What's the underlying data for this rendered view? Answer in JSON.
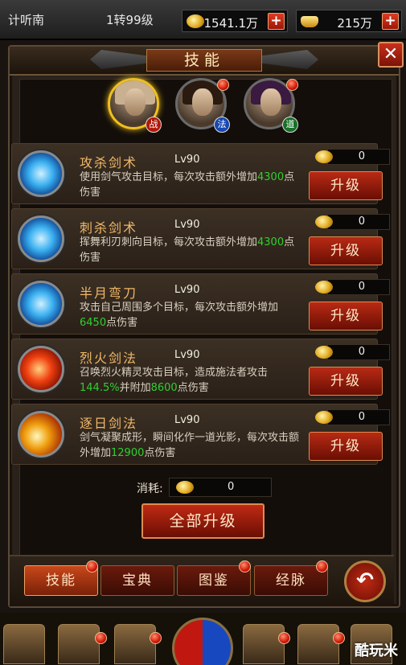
{
  "topbar": {
    "player_name": "计听南",
    "rank": "1转99级",
    "gold": "1541.1万",
    "yuanbao": "215万",
    "plus_label": "+"
  },
  "panel": {
    "title": "技能",
    "close_label": "✕"
  },
  "characters": [
    {
      "class_label": "战",
      "class_color": "#b01808",
      "selected": true,
      "has_dot": false
    },
    {
      "class_label": "法",
      "class_color": "#1848b0",
      "selected": false,
      "has_dot": true
    },
    {
      "class_label": "道",
      "class_color": "#187028",
      "selected": false,
      "has_dot": true
    }
  ],
  "skills": [
    {
      "name": "攻杀剑术",
      "level": "Lv90",
      "cost": "0",
      "desc_pre": "使用剑气攻击目标，每次攻击额外增加",
      "desc_mid_pre": "",
      "val1": "4300",
      "desc_post": "点伤害",
      "val2": "",
      "desc_end": "",
      "icon": "blue"
    },
    {
      "name": "刺杀剑术",
      "level": "Lv90",
      "cost": "0",
      "desc_pre": "挥舞利刃刺向目标，每次攻击额外增加",
      "desc_mid_pre": "",
      "val1": "4300",
      "desc_post": "点伤害",
      "val2": "",
      "desc_end": "",
      "icon": "blue"
    },
    {
      "name": "半月弯刀",
      "level": "Lv90",
      "cost": "0",
      "desc_pre": "攻击自己周围多个目标，每次攻击额外增",
      "desc_mid_pre": "加",
      "val1": "6450",
      "desc_post": "点伤害",
      "val2": "",
      "desc_end": "",
      "icon": "blue"
    },
    {
      "name": "烈火剑法",
      "level": "Lv90",
      "cost": "0",
      "desc_pre": "召唤烈火精灵攻击目标，造成施法者攻击",
      "desc_mid_pre": "",
      "val1": "144.5%",
      "desc_post": "并附加",
      "val2": "8600",
      "desc_end": "点伤害",
      "icon": "red"
    },
    {
      "name": "逐日剑法",
      "level": "Lv90",
      "cost": "0",
      "desc_pre": "剑气凝聚成形，瞬间化作一道光影，每次",
      "desc_mid_pre": "攻击额外增加",
      "val1": "12900",
      "desc_post": "点伤害",
      "val2": "",
      "desc_end": "",
      "icon": "fire"
    }
  ],
  "upgrade_label": "升级",
  "consume": {
    "label": "消耗:",
    "value": "0"
  },
  "upgrade_all_label": "全部升级",
  "tabs": [
    {
      "label": "技能",
      "active": true,
      "has_dot": true
    },
    {
      "label": "宝典",
      "active": false,
      "has_dot": false
    },
    {
      "label": "图鉴",
      "active": false,
      "has_dot": true
    },
    {
      "label": "经脉",
      "active": false,
      "has_dot": true
    }
  ],
  "back_icon": "undo-arrow-icon",
  "watermark": "酷玩米"
}
